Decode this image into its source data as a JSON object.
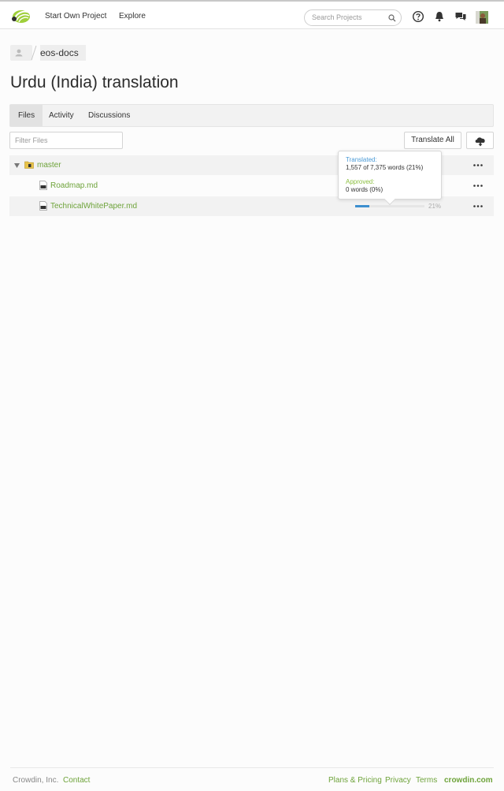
{
  "header": {
    "nav": [
      "Start Own Project",
      "Explore"
    ],
    "search_placeholder": "Search Projects",
    "icons": [
      "crowdin-logo-icon",
      "search-icon",
      "help-icon",
      "notifications-bell-icon",
      "messages-icon",
      "user-avatar"
    ]
  },
  "breadcrumb": {
    "project": "eos-docs"
  },
  "page_title": "Urdu (India) translation",
  "tabs": [
    {
      "label": "Files",
      "active": true
    },
    {
      "label": "Activity",
      "active": false
    },
    {
      "label": "Discussions",
      "active": false
    }
  ],
  "filter_placeholder": "Filter Files",
  "translate_all_label": "Translate All",
  "files": {
    "folder": "master",
    "items": [
      {
        "name": "Roadmap.md"
      },
      {
        "name": "TechnicalWhitePaper.md",
        "progress": 21,
        "progress_label": "21%"
      }
    ]
  },
  "tooltip": {
    "translated_head": "Translated:",
    "translated_value": "1,557 of 7,375 words (21%)",
    "approved_head": "Approved:",
    "approved_value": "0 words (0%)"
  },
  "footer": {
    "company": "Crowdin, Inc.",
    "contact": "Contact",
    "plans": "Plans & Pricing",
    "privacy": "Privacy",
    "terms": "Terms",
    "brand": "crowdin.com"
  },
  "colors": {
    "accent_green": "#6ea33a",
    "progress_blue": "#3d8fcf",
    "translated_blue": "#4a9ad6",
    "approved_green": "#8bbf3f"
  }
}
